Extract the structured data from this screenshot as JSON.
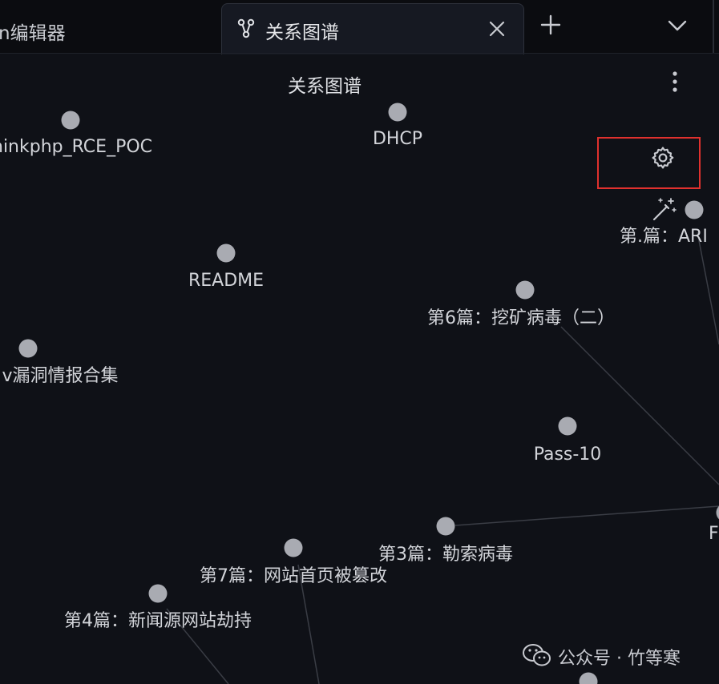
{
  "tabs": [
    {
      "label": "n编辑器",
      "active": false
    },
    {
      "label": "关系图谱",
      "active": true,
      "icon": "graph-icon"
    }
  ],
  "tab_actions": {
    "add_icon": "plus-icon",
    "menu_icon": "chevron-down-icon",
    "close_icon": "close-icon"
  },
  "view": {
    "title": "关系图谱",
    "more_icon": "more-vertical-icon"
  },
  "controls": {
    "settings_icon": "gear-icon",
    "magic_icon": "magic-wand-icon",
    "highlight_color": "#e0312e"
  },
  "graph": {
    "node_color": "#a9abb2",
    "nodes": [
      {
        "label": "hinkphp_RCE_POC"
      },
      {
        "label": "DHCP"
      },
      {
        "label": "README"
      },
      {
        "label": "第6篇：挖矿病毒（二）"
      },
      {
        "label": "v漏洞情报合集"
      },
      {
        "label": "Pass-10"
      },
      {
        "label": "第3篇：勒索病毒"
      },
      {
        "label": "第7篇：网站首页被篡改"
      },
      {
        "label": "第4篇：新闻源网站劫持"
      },
      {
        "label": "第.篇：ARI"
      },
      {
        "label": "F"
      },
      {
        "label": ""
      }
    ]
  },
  "watermark": {
    "text": "公众号 · 竹等寒",
    "icon": "wechat-icon"
  }
}
